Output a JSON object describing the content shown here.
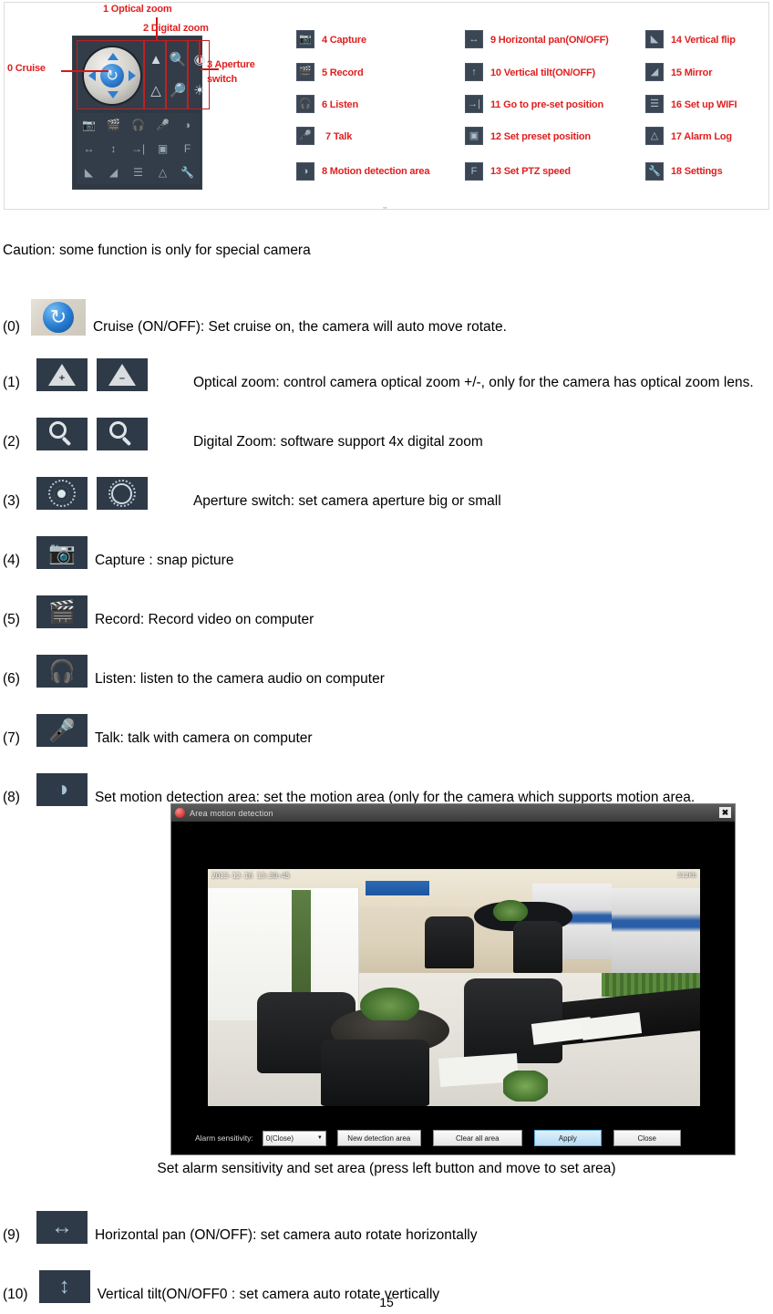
{
  "figure": {
    "left_labels": [
      {
        "id": "0",
        "text": "0 Cruise"
      },
      {
        "id": "1",
        "text": "1 Optical zoom"
      },
      {
        "id": "2",
        "text": "2 Digital zoom"
      },
      {
        "id": "3a",
        "text": "3 Aperture"
      },
      {
        "id": "3b",
        "text": "switch"
      }
    ],
    "column2": [
      {
        "num": "4",
        "text": "4 Capture",
        "icon": "camera-icon"
      },
      {
        "num": "5",
        "text": "5 Record",
        "icon": "clapperboard-icon"
      },
      {
        "num": "6",
        "text": "6 Listen",
        "icon": "headphones-icon"
      },
      {
        "num": "7",
        "text": "7 Talk",
        "icon": "microphone-icon"
      },
      {
        "num": "8",
        "text": "8 Motion detection area",
        "icon": "motion-radar-icon"
      }
    ],
    "column3": [
      {
        "num": "9",
        "text": "9 Horizontal pan(ON/OFF)",
        "icon": "horizontal-arrows-icon"
      },
      {
        "num": "10",
        "text": "10 Vertical tilt(ON/OFF)",
        "icon": "vertical-arrow-icon"
      },
      {
        "num": "11",
        "text": "11 Go to pre-set position",
        "icon": "goto-preset-icon"
      },
      {
        "num": "12",
        "text": "12 Set preset position",
        "icon": "set-preset-icon"
      },
      {
        "num": "13",
        "text": "13 Set PTZ speed",
        "icon": "ptz-speed-icon"
      }
    ],
    "column4": [
      {
        "num": "14",
        "text": "14 Vertical flip",
        "icon": "vertical-flip-icon"
      },
      {
        "num": "15",
        "text": "15 Mirror",
        "icon": "mirror-icon"
      },
      {
        "num": "16",
        "text": "16 Set up WIFI",
        "icon": "wifi-icon"
      },
      {
        "num": "17",
        "text": "17 Alarm Log",
        "icon": "alarm-warning-icon"
      },
      {
        "num": "18",
        "text": "18 Settings",
        "icon": "wrench-icon"
      }
    ],
    "label_color": "#e02020",
    "panel_bg": "#2f3944"
  },
  "body": {
    "caution": "Caution: some function is only for special camera",
    "entries": [
      {
        "num": "(0)",
        "desc": "Cruise (ON/OFF): Set cruise on, the camera will auto move rotate."
      },
      {
        "num": "(1)",
        "desc": "Optical zoom: control camera optical zoom +/-, only for the camera has optical zoom lens."
      },
      {
        "num": "(2)",
        "desc": "Digital Zoom: software support 4x digital zoom"
      },
      {
        "num": "(3)",
        "desc": "Aperture switch: set camera aperture big or small"
      },
      {
        "num": "(4)",
        "desc": "Capture : snap picture"
      },
      {
        "num": "(5)",
        "desc": "Record: Record video on computer"
      },
      {
        "num": "(6)",
        "desc": "Listen: listen to the camera audio on computer"
      },
      {
        "num": "(7)",
        "desc": "Talk: talk with camera on computer"
      },
      {
        "num": "(8)",
        "desc": "Set motion detection area: set the motion area (only for the camera which supports motion area."
      },
      {
        "num": "(9)",
        "desc": "Horizontal pan (ON/OFF): set camera auto rotate horizontally"
      },
      {
        "num": "(10)",
        "desc": "Vertical tilt(ON/OFF0 : set camera auto rotate vertically"
      }
    ]
  },
  "dialog": {
    "title": "Area motion detection",
    "close_glyph": "✖",
    "video": {
      "timestamp": "2013-12-16 13:30:45",
      "bitrate": "312Kb"
    },
    "toolbar": {
      "sensitivity_label": "Alarm sensitivity:",
      "sensitivity_value": "0(Close)",
      "sensitivity_options": [
        "0(Close)"
      ],
      "new_area_button": "New detection area",
      "clear_area_button": "Clear all area",
      "apply_button": "Apply",
      "close_button": "Close"
    }
  },
  "dialog_caption": "Set alarm sensitivity and set area (press left button and move to set area)",
  "page_number": "15",
  "figure_tick": "‚‚"
}
